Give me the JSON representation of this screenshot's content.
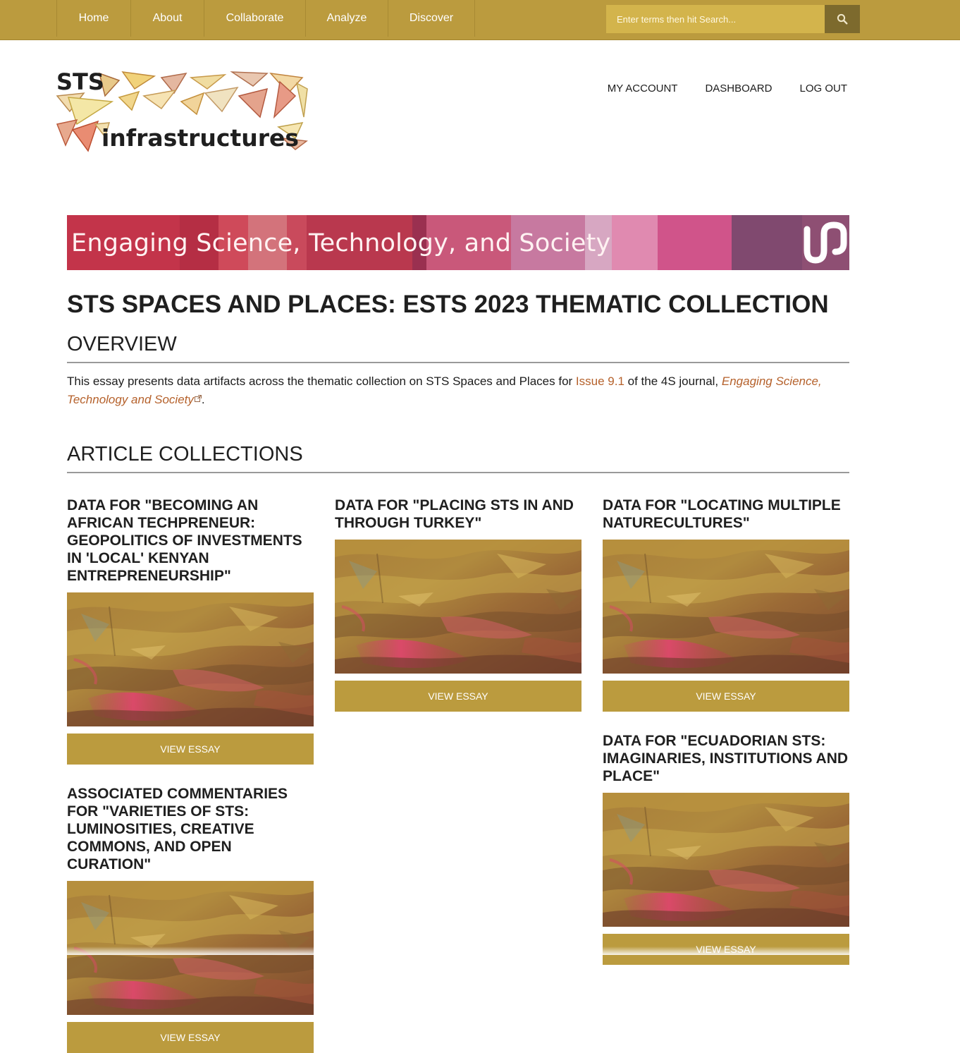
{
  "nav": {
    "items": [
      {
        "label": "Home"
      },
      {
        "label": "About"
      },
      {
        "label": "Collaborate"
      },
      {
        "label": "Analyze"
      },
      {
        "label": "Discover"
      }
    ],
    "search_placeholder": "Enter terms then hit Search...",
    "search_icon": "search-icon"
  },
  "logo": {
    "line1": "STS",
    "line2": "infrastructures"
  },
  "account": {
    "my_account": "My Account",
    "dashboard": "Dashboard",
    "log_out": "Log Out"
  },
  "banner": {
    "text": "Engaging Science, Technology, and Society"
  },
  "page": {
    "title": "STS SPACES AND PLACES: ESTS 2023 THEMATIC COLLECTION"
  },
  "overview": {
    "heading": "OVERVIEW",
    "text_before": "This essay presents data artifacts across the thematic collection on STS Spaces and Places for ",
    "issue_link": "Issue 9.1",
    "text_middle": " of the 4S journal, ",
    "journal_link": "Engaging Science, Technology and Society",
    "text_after": "."
  },
  "collections": {
    "heading": "ARTICLE COLLECTIONS",
    "items": [
      {
        "title": "DATA FOR \"BECOMING AN AFRICAN TECHPRENEUR: GEOPOLITICS OF INVESTMENTS IN 'LOCAL' KENYAN ENTREPRENEURSHIP\"",
        "button": "View Essay"
      },
      {
        "title": "DATA FOR \"PLACING STS IN AND THROUGH TURKEY\"",
        "button": "View Essay"
      },
      {
        "title": "DATA FOR \"LOCATING MULTIPLE NATURECULTURES\"",
        "button": "View Essay"
      },
      {
        "title": "ASSOCIATED COMMENTARIES FOR \"VARIETIES OF STS: LUMINOSITIES, CREATIVE COMMONS, AND OPEN CURATION\"",
        "button": "View Essay"
      },
      {
        "title": "DATA FOR \"ECUADORIAN STS: IMAGINARIES, INSTITUTIONS AND PLACE\"",
        "button": "View Essay"
      }
    ]
  },
  "colors": {
    "accent": "#bb9b3e",
    "link": "#b5612b",
    "search_button": "#7d6a2d"
  }
}
